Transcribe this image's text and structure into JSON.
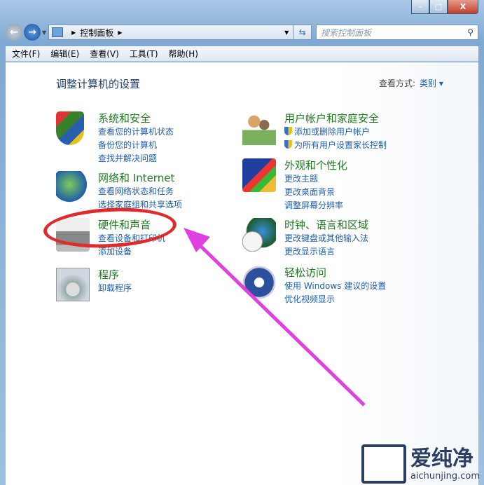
{
  "window": {
    "minimize": "–",
    "maximize": "□",
    "close": "X"
  },
  "nav": {
    "breadcrumb": "控制面板",
    "search_placeholder": "搜索控制面板"
  },
  "menu": [
    "文件(F)",
    "编辑(E)",
    "查看(V)",
    "工具(T)",
    "帮助(H)"
  ],
  "main": {
    "title": "调整计算机的设置",
    "view_by_label": "查看方式:",
    "view_by_value": "类别 ▾"
  },
  "categories": [
    {
      "title": "系统和安全",
      "links": [
        "查看您的计算机状态",
        "备份您的计算机",
        "查找并解决问题"
      ]
    },
    {
      "title": "网络和 Internet",
      "links": [
        "查看网络状态和任务",
        "选择家庭组和共享选项"
      ]
    },
    {
      "title": "硬件和声音",
      "links": [
        "查看设备和打印机",
        "添加设备"
      ]
    },
    {
      "title": "程序",
      "links": [
        "卸载程序"
      ]
    },
    {
      "title": "用户帐户和家庭安全",
      "links": [
        "添加或删除用户帐户",
        "为所有用户设置家长控制"
      ]
    },
    {
      "title": "外观和个性化",
      "links": [
        "更改主题",
        "更改桌面背景",
        "调整屏幕分辨率"
      ]
    },
    {
      "title": "时钟、语言和区域",
      "links": [
        "更改键盘或其他输入法",
        "更改显示语言"
      ]
    },
    {
      "title": "轻松访问",
      "links": [
        "使用 Windows 建议的设置",
        "优化视频显示"
      ]
    }
  ],
  "watermark": {
    "name": "爱纯净",
    "url": "aichunjing.com"
  },
  "colors": {
    "annotation_circle": "#e02b2b",
    "annotation_arrow": "#e040e0"
  }
}
